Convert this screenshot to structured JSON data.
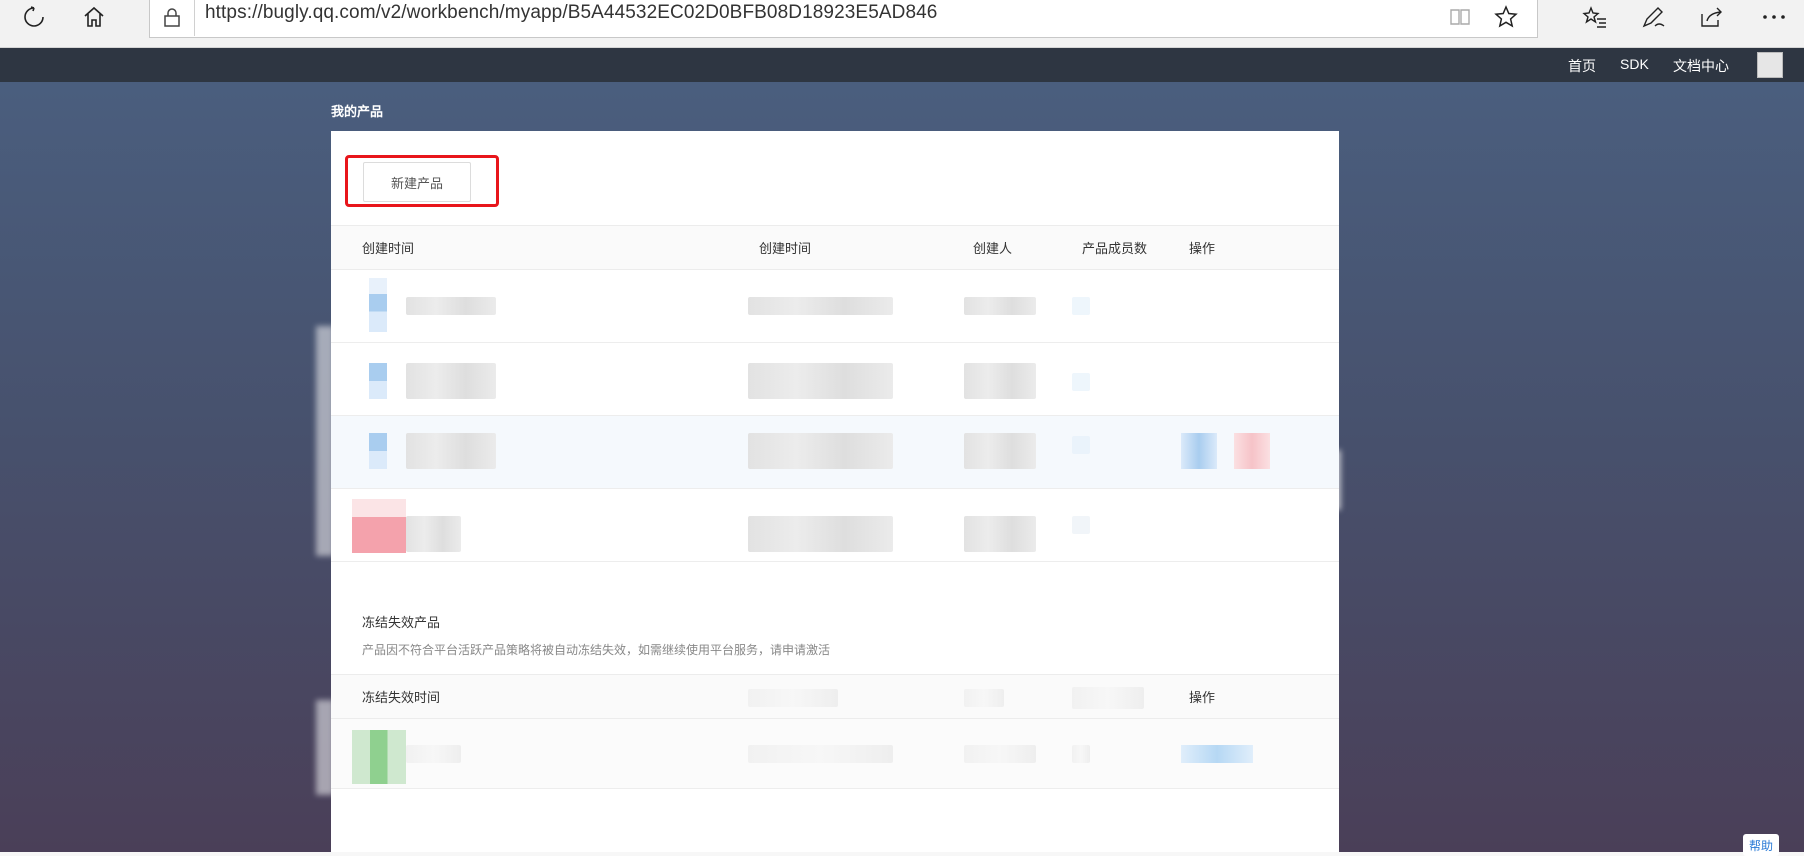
{
  "browser": {
    "url": "https://bugly.qq.com/v2/workbench/myapp/B5A44532EC02D0BFB08D18923E5AD846"
  },
  "nav": {
    "links": [
      "首页",
      "SDK",
      "文档中心"
    ]
  },
  "page": {
    "title": "我的产品",
    "new_product_button": "新建产品",
    "help": "帮助"
  },
  "products_table": {
    "headers": [
      "创建时间",
      "创建时间",
      "创建人",
      "产品成员数",
      "操作"
    ]
  },
  "frozen_section": {
    "title": "冻结失效产品",
    "description": "产品因不符合平台活跃产品策略将被自动冻结失效，如需继续使用平台服务，请申请激活",
    "headers": [
      "冻结失效时间",
      "操作"
    ]
  },
  "colors": {
    "highlight": "#e8151b",
    "nav_bg": "#2e3642"
  }
}
